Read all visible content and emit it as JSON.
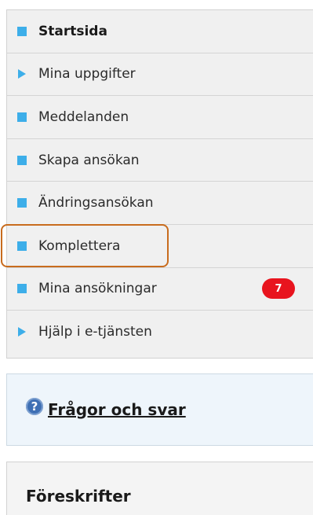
{
  "nav": {
    "items": [
      {
        "label": "Startsida",
        "marker": "square-bullet-icon",
        "bold": true
      },
      {
        "label": "Mina uppgifter",
        "marker": "triangle-arrow-icon"
      },
      {
        "label": "Meddelanden",
        "marker": "square-bullet-icon"
      },
      {
        "label": "Skapa ansökan",
        "marker": "square-bullet-icon"
      },
      {
        "label": "Ändringsansökan",
        "marker": "square-bullet-icon"
      },
      {
        "label": "Komplettera",
        "marker": "square-bullet-icon",
        "highlighted": true
      },
      {
        "label": "Mina ansökningar",
        "marker": "square-bullet-icon",
        "badge": "7"
      },
      {
        "label": "Hjälp i e-tjänsten",
        "marker": "triangle-arrow-icon"
      }
    ]
  },
  "faq": {
    "icon": "help-question-icon",
    "icon_glyph": "?",
    "label": "Frågor och svar"
  },
  "rules": {
    "title": "Föreskrifter"
  },
  "colors": {
    "bullet": "#3daee9",
    "badge": "#e8141e",
    "highlight": "#c86c1e",
    "faq_bg": "#eef5fb"
  }
}
